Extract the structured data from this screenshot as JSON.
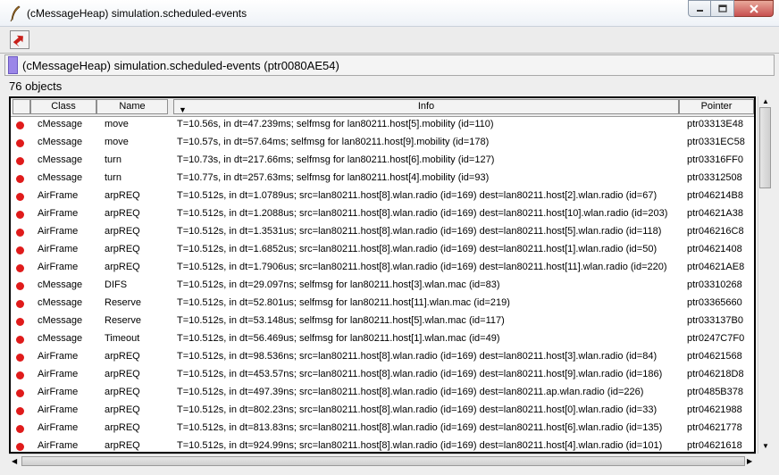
{
  "window": {
    "title": "(cMessageHeap) simulation.scheduled-events",
    "controls": {
      "minimize": "minimize-icon",
      "maximize": "maximize-icon",
      "close": "close-icon"
    }
  },
  "toolbar": {
    "inspect_parent_icon": "up-arrow-icon"
  },
  "object": {
    "label": "(cMessageHeap) simulation.scheduled-events  (ptr0080AE54)",
    "swatch_color": "#9b86e8"
  },
  "list": {
    "count_label": "76 objects",
    "headers": {
      "class": "Class",
      "name": "Name",
      "info": "Info",
      "pointer": "Pointer",
      "sort_indicator": "▼"
    },
    "status_color": "#e01b1b",
    "rows": [
      {
        "class": "cMessage",
        "name": "move",
        "info": "T=10.56s, in dt=47.239ms; selfmsg for lan80211.host[5].mobility (id=110)",
        "pointer": "ptr03313E48"
      },
      {
        "class": "cMessage",
        "name": "move",
        "info": "T=10.57s, in dt=57.64ms; selfmsg for lan80211.host[9].mobility (id=178)",
        "pointer": "ptr0331EC58"
      },
      {
        "class": "cMessage",
        "name": "turn",
        "info": "T=10.73s, in dt=217.66ms; selfmsg for lan80211.host[6].mobility (id=127)",
        "pointer": "ptr03316FF0"
      },
      {
        "class": "cMessage",
        "name": "turn",
        "info": "T=10.77s, in dt=257.63ms; selfmsg for lan80211.host[4].mobility (id=93)",
        "pointer": "ptr03312508"
      },
      {
        "class": "AirFrame",
        "name": "arpREQ",
        "info": "T=10.512s, in dt=1.0789us; src=lan80211.host[8].wlan.radio (id=169)  dest=lan80211.host[2].wlan.radio (id=67)",
        "pointer": "ptr046214B8"
      },
      {
        "class": "AirFrame",
        "name": "arpREQ",
        "info": "T=10.512s, in dt=1.2088us; src=lan80211.host[8].wlan.radio (id=169)  dest=lan80211.host[10].wlan.radio (id=203)",
        "pointer": "ptr04621A38"
      },
      {
        "class": "AirFrame",
        "name": "arpREQ",
        "info": "T=10.512s, in dt=1.3531us; src=lan80211.host[8].wlan.radio (id=169)  dest=lan80211.host[5].wlan.radio (id=118)",
        "pointer": "ptr046216C8"
      },
      {
        "class": "AirFrame",
        "name": "arpREQ",
        "info": "T=10.512s, in dt=1.6852us; src=lan80211.host[8].wlan.radio (id=169)  dest=lan80211.host[1].wlan.radio (id=50)",
        "pointer": "ptr04621408"
      },
      {
        "class": "AirFrame",
        "name": "arpREQ",
        "info": "T=10.512s, in dt=1.7906us; src=lan80211.host[8].wlan.radio (id=169)  dest=lan80211.host[11].wlan.radio (id=220)",
        "pointer": "ptr04621AE8"
      },
      {
        "class": "cMessage",
        "name": "DIFS",
        "info": "T=10.512s, in dt=29.097ns; selfmsg for lan80211.host[3].wlan.mac (id=83)",
        "pointer": "ptr03310268"
      },
      {
        "class": "cMessage",
        "name": "Reserve",
        "info": "T=10.512s, in dt=52.801us; selfmsg for lan80211.host[11].wlan.mac (id=219)",
        "pointer": "ptr03365660"
      },
      {
        "class": "cMessage",
        "name": "Reserve",
        "info": "T=10.512s, in dt=53.148us; selfmsg for lan80211.host[5].wlan.mac (id=117)",
        "pointer": "ptr033137B0"
      },
      {
        "class": "cMessage",
        "name": "Timeout",
        "info": "T=10.512s, in dt=56.469us; selfmsg for lan80211.host[1].wlan.mac (id=49)",
        "pointer": "ptr0247C7F0"
      },
      {
        "class": "AirFrame",
        "name": "arpREQ",
        "info": "T=10.512s, in dt=98.536ns; src=lan80211.host[8].wlan.radio (id=169)  dest=lan80211.host[3].wlan.radio (id=84)",
        "pointer": "ptr04621568"
      },
      {
        "class": "AirFrame",
        "name": "arpREQ",
        "info": "T=10.512s, in dt=453.57ns; src=lan80211.host[8].wlan.radio (id=169)  dest=lan80211.host[9].wlan.radio (id=186)",
        "pointer": "ptr046218D8"
      },
      {
        "class": "AirFrame",
        "name": "arpREQ",
        "info": "T=10.512s, in dt=497.39ns; src=lan80211.host[8].wlan.radio (id=169)  dest=lan80211.ap.wlan.radio (id=226)",
        "pointer": "ptr0485B378"
      },
      {
        "class": "AirFrame",
        "name": "arpREQ",
        "info": "T=10.512s, in dt=802.23ns; src=lan80211.host[8].wlan.radio (id=169)  dest=lan80211.host[0].wlan.radio (id=33)",
        "pointer": "ptr04621988"
      },
      {
        "class": "AirFrame",
        "name": "arpREQ",
        "info": "T=10.512s, in dt=813.83ns; src=lan80211.host[8].wlan.radio (id=169)  dest=lan80211.host[6].wlan.radio (id=135)",
        "pointer": "ptr04621778"
      },
      {
        "class": "AirFrame",
        "name": "arpREQ",
        "info": "T=10.512s, in dt=924.99ns; src=lan80211.host[8].wlan.radio (id=169)  dest=lan80211.host[4].wlan.radio (id=101)",
        "pointer": "ptr04621618"
      }
    ]
  }
}
